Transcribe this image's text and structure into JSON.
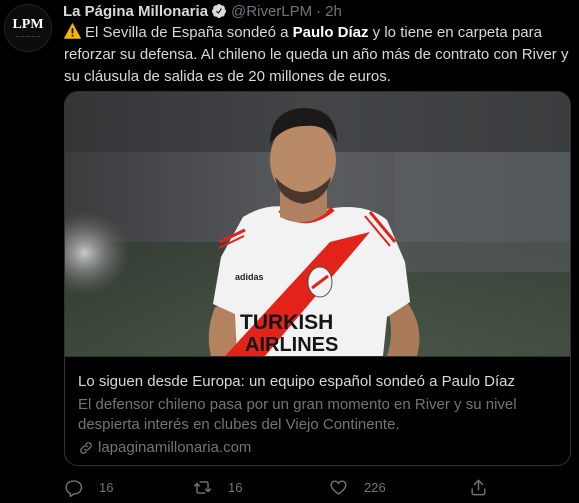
{
  "tweet": {
    "avatar_text": "LPM",
    "author_name": "La Página Millonaria",
    "handle": "@RiverLPM",
    "separator": "·",
    "time": "2h",
    "text_1": "El Sevilla de España sondeó a ",
    "text_bold": "Paulo Díaz",
    "text_2": " y lo tiene en carpeta para reforzar su defensa. Al chileno le queda un año más de contrato con River y su cláusula de salida es de 20 millones de euros."
  },
  "card": {
    "jersey_text_1": "TURKISH",
    "jersey_text_2": "AIRLINES",
    "jersey_brand": "adidas",
    "title": "Lo siguen desde Europa: un equipo español sondeó a Paulo Díaz",
    "description": "El defensor chileno pasa por un gran momento en River y su nivel despierta interés en clubes del Viejo Continente.",
    "domain": "lapaginamillonaria.com"
  },
  "actions": {
    "replies": "16",
    "retweets": "16",
    "likes": "226"
  },
  "colors": {
    "background": "#000000",
    "text": "#d9d9d9",
    "muted": "#6e767d",
    "border": "#2f3336",
    "river_red": "#e2231a",
    "verified_badge": "#d9d9d9"
  },
  "icons": [
    "warning-icon",
    "verified-icon",
    "link-icon",
    "reply-icon",
    "retweet-icon",
    "like-icon",
    "share-icon"
  ]
}
